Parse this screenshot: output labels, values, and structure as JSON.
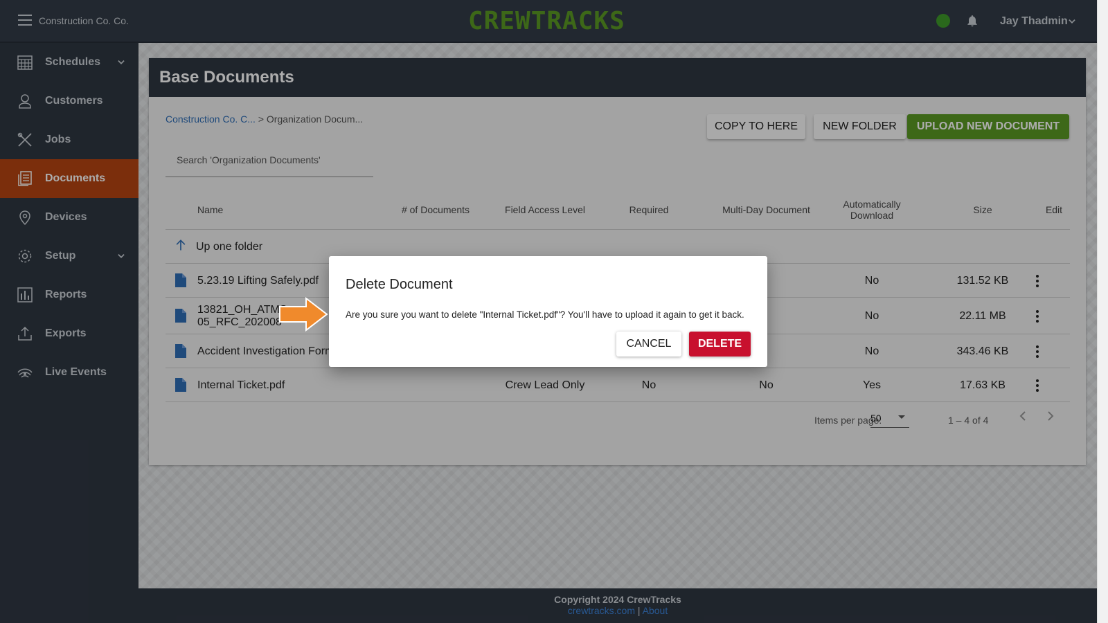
{
  "header": {
    "org_name": "Construction Co. Co.",
    "logo_text": "CREWTRACKS",
    "user_name": "Jay Thadmin",
    "status_color": "#3f9a2a"
  },
  "sidebar": {
    "active_color": "#b64512",
    "items": [
      {
        "label": "Schedules",
        "icon": "calendar-icon",
        "has_submenu": true
      },
      {
        "label": "Customers",
        "icon": "customer-icon",
        "has_submenu": false
      },
      {
        "label": "Jobs",
        "icon": "tools-icon",
        "has_submenu": false
      },
      {
        "label": "Documents",
        "icon": "documents-icon",
        "has_submenu": false,
        "active": true
      },
      {
        "label": "Devices",
        "icon": "location-pin-icon",
        "has_submenu": false
      },
      {
        "label": "Setup",
        "icon": "gear-icon",
        "has_submenu": true
      },
      {
        "label": "Reports",
        "icon": "bar-chart-icon",
        "has_submenu": false
      },
      {
        "label": "Exports",
        "icon": "export-icon",
        "has_submenu": false
      },
      {
        "label": "Live Events",
        "icon": "broadcast-icon",
        "has_submenu": false
      }
    ]
  },
  "page": {
    "title": "Base Documents",
    "breadcrumb_link": "Construction Co. C...",
    "breadcrumb_current": "> Organization Docum...",
    "buttons": {
      "copy": "COPY TO HERE",
      "new_folder": "NEW FOLDER",
      "upload": "UPLOAD NEW DOCUMENT"
    },
    "search_placeholder": "Search 'Organization Documents'"
  },
  "table": {
    "columns": {
      "name": "Name",
      "num_docs": "# of Documents",
      "field_access": "Field Access Level",
      "required": "Required",
      "multi_day": "Multi-Day Document",
      "auto_download": "Automatically Download",
      "size": "Size",
      "edit": "Edit"
    },
    "up_folder": "Up one folder",
    "rows": [
      {
        "name": "5.23.19 Lifting Safely.pdf",
        "field_access": "",
        "required": "",
        "multi_day": "",
        "auto_download": "No",
        "size": "131.52 KB"
      },
      {
        "name": "13821_OH_ATMS 05_RFC_202008",
        "field_access": "",
        "required": "",
        "multi_day": "",
        "auto_download": "No",
        "size": "22.11 MB"
      },
      {
        "name": "Accident Investigation Form",
        "field_access": "",
        "required": "",
        "multi_day": "",
        "auto_download": "No",
        "size": "343.46 KB"
      },
      {
        "name": "Internal Ticket.pdf",
        "field_access": "Crew Lead Only",
        "required": "No",
        "multi_day": "No",
        "auto_download": "Yes",
        "size": "17.63 KB"
      }
    ]
  },
  "pagination": {
    "items_per_page_label": "Items per page:",
    "items_per_page": "50",
    "range": "1 – 4 of 4"
  },
  "footer": {
    "copyright": "Copyright 2024 CrewTracks",
    "link1": "crewtracks.com",
    "separator": "|",
    "link2": "About"
  },
  "dialog": {
    "title": "Delete Document",
    "message": "Are you sure you want to delete \"Internal Ticket.pdf\"? You'll have to upload it again to get it back.",
    "cancel": "CANCEL",
    "delete": "DELETE",
    "delete_color": "#c8102e"
  }
}
